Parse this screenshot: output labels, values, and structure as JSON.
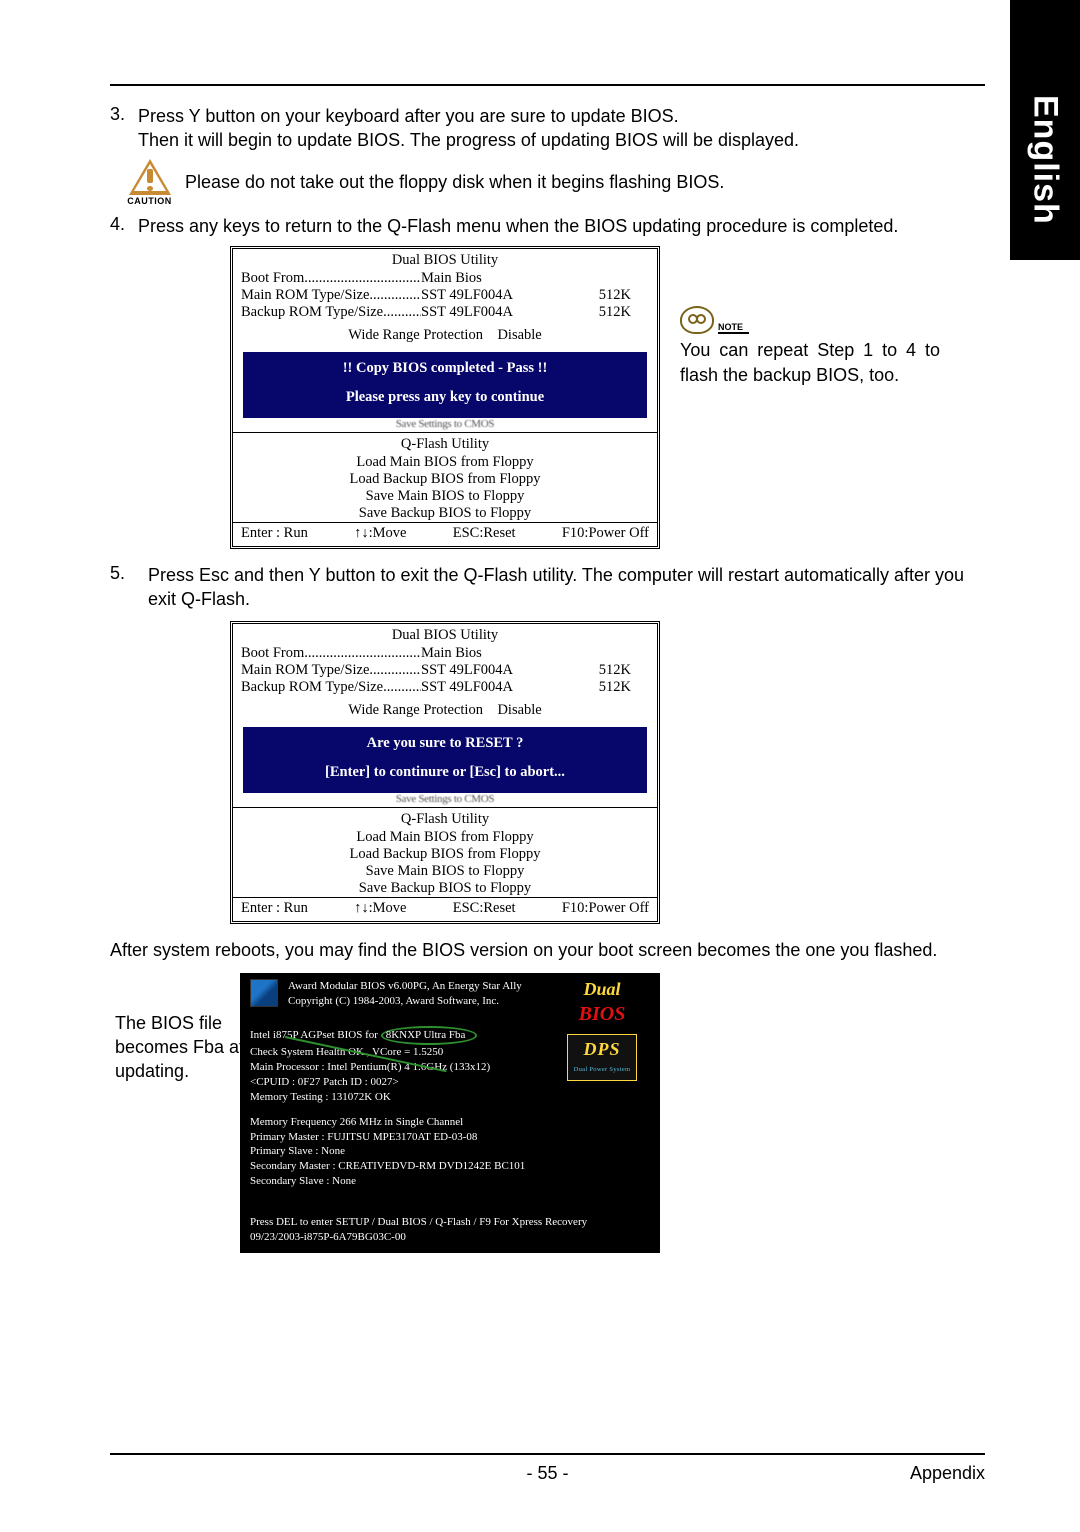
{
  "side_tab": "English",
  "steps": {
    "s3": {
      "num": "3.",
      "line1": "Press Y button on your keyboard after you are sure to update BIOS.",
      "line2": "Then it will begin to update BIOS. The progress of updating BIOS will be displayed."
    },
    "caution": {
      "label": "CAUTION",
      "text": "Please do not take out the floppy disk when it begins flashing BIOS."
    },
    "s4": {
      "num": "4.",
      "text": "Press any keys to return to the Q-Flash menu when the BIOS updating procedure is completed."
    },
    "s5": {
      "num": "5.",
      "text": "Press Esc and then Y button to exit the Q-Flash utility. The computer will restart automatically after you exit Q-Flash."
    }
  },
  "bios_box1": {
    "title": "Dual BIOS Utility",
    "boot_from": {
      "label": "Boot From........................................",
      "val": "Main Bios"
    },
    "main_rom": {
      "label": "Main ROM Type/Size......................",
      "val": "SST 49LF004A",
      "size": "512K"
    },
    "backup_rom": {
      "label": "Backup ROM Type/Size..................",
      "val": "SST 49LF004A",
      "size": "512K"
    },
    "wide": {
      "label": "Wide Range Protection",
      "val": "Disable"
    },
    "hl": {
      "l1": "!! Copy BIOS completed - Pass !!",
      "l2": "Please press any key to continue"
    },
    "smudge": "Save Settings to CMOS",
    "qflash": "Q-Flash Utility",
    "list": [
      "Load Main BIOS from Floppy",
      "Load Backup BIOS from Floppy",
      "Save Main BIOS to Floppy",
      "Save Backup BIOS to Floppy"
    ],
    "foot": {
      "a": "Enter : Run",
      "b": "↑↓:Move",
      "c": "ESC:Reset",
      "d": "F10:Power Off"
    }
  },
  "note": {
    "label": "NOTE",
    "text": "You can repeat Step 1 to 4 to flash the backup BIOS, too."
  },
  "bios_box2": {
    "hl": {
      "l1": "Are you sure to RESET ?",
      "l2": "[Enter] to continure or [Esc] to abort..."
    }
  },
  "after_text": "After system reboots, you may find the BIOS version on your boot screen becomes the one you flashed.",
  "callout": "The BIOS file becomes Fba after updating.",
  "boot": {
    "head1": "Award Modular BIOS v6.00PG, An Energy Star Ally",
    "head2": "Copyright  (C) 1984-2003, Award Software,  Inc.",
    "l1a": "Intel i875P AGPset BIOS for",
    "l1b": "8KNXP Ultra Fba",
    "l2": "Check System Health OK , VCore = 1.5250",
    "l3": "Main Processor : Intel Pentium(R) 4  1.6GHz (133x12)",
    "l4": "<CPUID : 0F27 Patch ID : 0027>",
    "l5": "Memory Testing  : 131072K OK",
    "l6": "Memory Frequency 266 MHz in Single Channel",
    "l7": "Primary Master : FUJITSU MPE3170AT ED-03-08",
    "l8": "Primary Slave : None",
    "l9": "Secondary Master : CREATIVEDVD-RM DVD1242E BC101",
    "l10": "Secondary Slave : None",
    "f1": "Press DEL to enter SETUP / Dual BIOS / Q-Flash / F9 For Xpress Recovery",
    "f2": "09/23/2003-i875P-6A79BG03C-00",
    "badge1a": "Dual",
    "badge1b": "BIOS",
    "badge2a": "DPS",
    "badge2b": "Dual Power System"
  },
  "footer": {
    "page": "- 55 -",
    "section": "Appendix"
  }
}
